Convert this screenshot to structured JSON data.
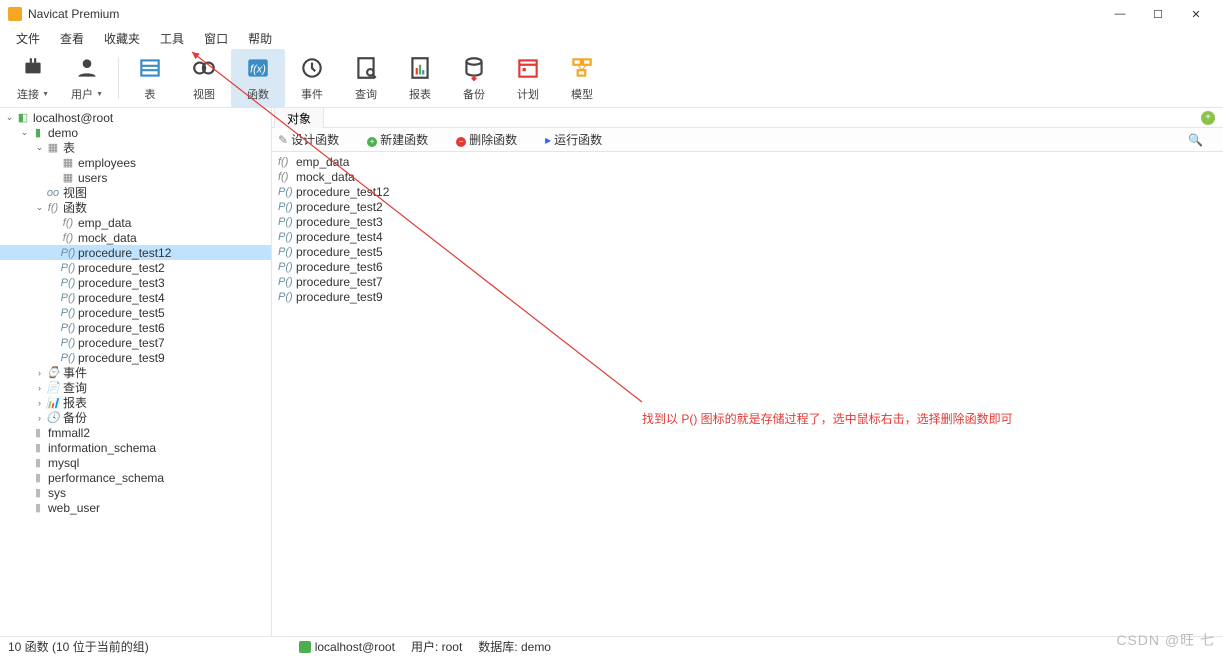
{
  "window": {
    "title": "Navicat Premium"
  },
  "menubar": [
    "文件",
    "查看",
    "收藏夹",
    "工具",
    "窗口",
    "帮助"
  ],
  "toolbar": [
    {
      "label": "连接",
      "icon": "connect",
      "drop": true
    },
    {
      "label": "用户",
      "icon": "user",
      "drop": true
    },
    {
      "sep": true
    },
    {
      "label": "表",
      "icon": "table"
    },
    {
      "label": "视图",
      "icon": "view"
    },
    {
      "label": "函数",
      "icon": "func",
      "active": true
    },
    {
      "label": "事件",
      "icon": "event"
    },
    {
      "label": "查询",
      "icon": "query"
    },
    {
      "label": "报表",
      "icon": "report"
    },
    {
      "label": "备份",
      "icon": "backup"
    },
    {
      "label": "计划",
      "icon": "schedule"
    },
    {
      "label": "模型",
      "icon": "model"
    }
  ],
  "tree": [
    {
      "d": 0,
      "exp": "open",
      "icon": "conn",
      "label": "localhost@root"
    },
    {
      "d": 1,
      "exp": "open",
      "icon": "db",
      "label": "demo"
    },
    {
      "d": 2,
      "exp": "open",
      "icon": "tbl",
      "label": "表"
    },
    {
      "d": 3,
      "exp": "",
      "icon": "tbl",
      "label": "employees"
    },
    {
      "d": 3,
      "exp": "",
      "icon": "tbl",
      "label": "users"
    },
    {
      "d": 2,
      "exp": "",
      "icon": "folder",
      "label": "视图",
      "pre": "oo"
    },
    {
      "d": 2,
      "exp": "open",
      "icon": "fn",
      "label": "函数",
      "pre": "f()"
    },
    {
      "d": 3,
      "exp": "",
      "icon": "fn",
      "label": "emp_data",
      "pre": "f()"
    },
    {
      "d": 3,
      "exp": "",
      "icon": "fn",
      "label": "mock_data",
      "pre": "f()"
    },
    {
      "d": 3,
      "exp": "",
      "icon": "proc",
      "label": "procedure_test12",
      "pre": "P()",
      "selected": true
    },
    {
      "d": 3,
      "exp": "",
      "icon": "proc",
      "label": "procedure_test2",
      "pre": "P()"
    },
    {
      "d": 3,
      "exp": "",
      "icon": "proc",
      "label": "procedure_test3",
      "pre": "P()"
    },
    {
      "d": 3,
      "exp": "",
      "icon": "proc",
      "label": "procedure_test4",
      "pre": "P()"
    },
    {
      "d": 3,
      "exp": "",
      "icon": "proc",
      "label": "procedure_test5",
      "pre": "P()"
    },
    {
      "d": 3,
      "exp": "",
      "icon": "proc",
      "label": "procedure_test6",
      "pre": "P()"
    },
    {
      "d": 3,
      "exp": "",
      "icon": "proc",
      "label": "procedure_test7",
      "pre": "P()"
    },
    {
      "d": 3,
      "exp": "",
      "icon": "proc",
      "label": "procedure_test9",
      "pre": "P()"
    },
    {
      "d": 2,
      "exp": "closed",
      "icon": "folder",
      "label": "事件",
      "pre": "⌚"
    },
    {
      "d": 2,
      "exp": "closed",
      "icon": "folder",
      "label": "查询",
      "pre": "📄"
    },
    {
      "d": 2,
      "exp": "closed",
      "icon": "folder",
      "label": "报表",
      "pre": "📊"
    },
    {
      "d": 2,
      "exp": "closed",
      "icon": "folder",
      "label": "备份",
      "pre": "🕓"
    },
    {
      "d": 1,
      "exp": "",
      "icon": "db2",
      "label": "fmmall2"
    },
    {
      "d": 1,
      "exp": "",
      "icon": "db2",
      "label": "information_schema"
    },
    {
      "d": 1,
      "exp": "",
      "icon": "db2",
      "label": "mysql"
    },
    {
      "d": 1,
      "exp": "",
      "icon": "db2",
      "label": "performance_schema"
    },
    {
      "d": 1,
      "exp": "",
      "icon": "db2",
      "label": "sys"
    },
    {
      "d": 1,
      "exp": "",
      "icon": "db2",
      "label": "web_user"
    }
  ],
  "tab": {
    "label": "对象"
  },
  "actions": {
    "design": "设计函数",
    "new": "新建函数",
    "delete": "删除函数",
    "run": "运行函数"
  },
  "objects": [
    {
      "icon": "fn",
      "label": "emp_data",
      "pre": "f()"
    },
    {
      "icon": "fn",
      "label": "mock_data",
      "pre": "f()"
    },
    {
      "icon": "proc",
      "label": "procedure_test12",
      "pre": "P()"
    },
    {
      "icon": "proc",
      "label": "procedure_test2",
      "pre": "P()"
    },
    {
      "icon": "proc",
      "label": "procedure_test3",
      "pre": "P()"
    },
    {
      "icon": "proc",
      "label": "procedure_test4",
      "pre": "P()"
    },
    {
      "icon": "proc",
      "label": "procedure_test5",
      "pre": "P()"
    },
    {
      "icon": "proc",
      "label": "procedure_test6",
      "pre": "P()"
    },
    {
      "icon": "proc",
      "label": "procedure_test7",
      "pre": "P()"
    },
    {
      "icon": "proc",
      "label": "procedure_test9",
      "pre": "P()"
    }
  ],
  "annotation": "找到以 P() 图标的就是存储过程了，选中鼠标右击，选择删除函数即可",
  "status": {
    "left": "10 函数 (10 位于当前的组)",
    "conn": "localhost@root",
    "user": "用户: root",
    "db": "数据库: demo"
  },
  "watermark": "CSDN @旺 七"
}
